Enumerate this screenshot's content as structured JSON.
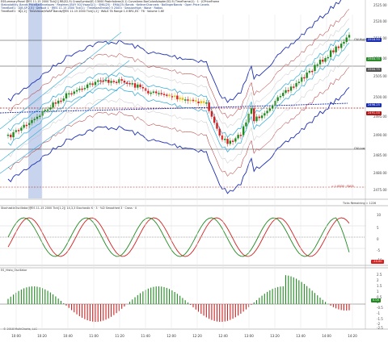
{
  "header": {
    "line1": "ESSummaryPanel @ES 11-15 2000 Tick[1] RB(52,9) CrossSymbol(E) 13000 PosInfoArea(0.1) CurveArea BarColorAdapter(52,9) TimeFrame(1) · 1 · JCPriceFrame",
    "line2": "Statvolatility_Bands PriceBarEnvelopes · Regimes  [BUY 50]  VwapQ(1) · SMA(25) · EMA(25) Bands · KeltnerChannels · BollingerBands · Open Price Levels",
    "line3": "TimeBarE1 · A[B,SP,2.5] · Default 1 · @ES 11-15 2000 Tick(1) · TimeBarsTrend(0 5 2500) · SessionHigh · Wave · Ratios",
    "line4": "TimeBarE1 · B[2,2] · TimeValue/VWAP Bands/@ES 11-15 2000 Tick[1,2] · WALK TA Range 1.0  BR1,ES · T6 · Volume 1.6E"
  },
  "price_axis": {
    "ticks": [
      "2525.00",
      "2520.00",
      "2515.00",
      "2510.00",
      "2505.00",
      "2500.00",
      "2495.00",
      "2490.00",
      "2485.00",
      "2480.00",
      "2475.00",
      "2470.00"
    ],
    "last_price": "2503.75",
    "tags": [
      "2518.50",
      "2504.75",
      "2496.25",
      "2491.00"
    ]
  },
  "annotations": {
    "cw_high": "CW-High",
    "cw_low": "CW-Low",
    "ticks_remaining": "Ticks Remaining = 1226",
    "lower_level": "= 1.0000 · FAG5"
  },
  "oscillator": {
    "title": "StochasticOscillator(@ES 11-15 2000 Tick[1,2]) 14,3,3 Stochastic K · 3 · %D Smoothed 3 · Cross · 0",
    "ticks": [
      "10",
      "5",
      "0",
      "-5",
      "-10"
    ],
    "last_value": "-10.00"
  },
  "histogram": {
    "title": "ES_Histo_Oscillator",
    "ticks": [
      "2.5",
      "2",
      "1.5",
      "1",
      "0.5",
      "0",
      "-0.5",
      "-1",
      "-1.5",
      "-2",
      "-2.5"
    ],
    "last_value": "0.00"
  },
  "time_axis": [
    "10:00",
    "10:20",
    "10:40",
    "11:00",
    "11:20",
    "11:40",
    "12:00",
    "12:20",
    "12:40",
    "13:00",
    "13:20",
    "13:40",
    "14:00",
    "14:20"
  ],
  "footer": "© 2018 MultiCharts, LLC",
  "colors": {
    "up": "#1f8a1f",
    "down": "#d42020",
    "neutral": "#e6c21a",
    "band_blue": "#1c2fb0",
    "band_cyan": "#2aa8d8",
    "band_red": "#b01818",
    "session_fill": "#c8d4ee"
  }
}
